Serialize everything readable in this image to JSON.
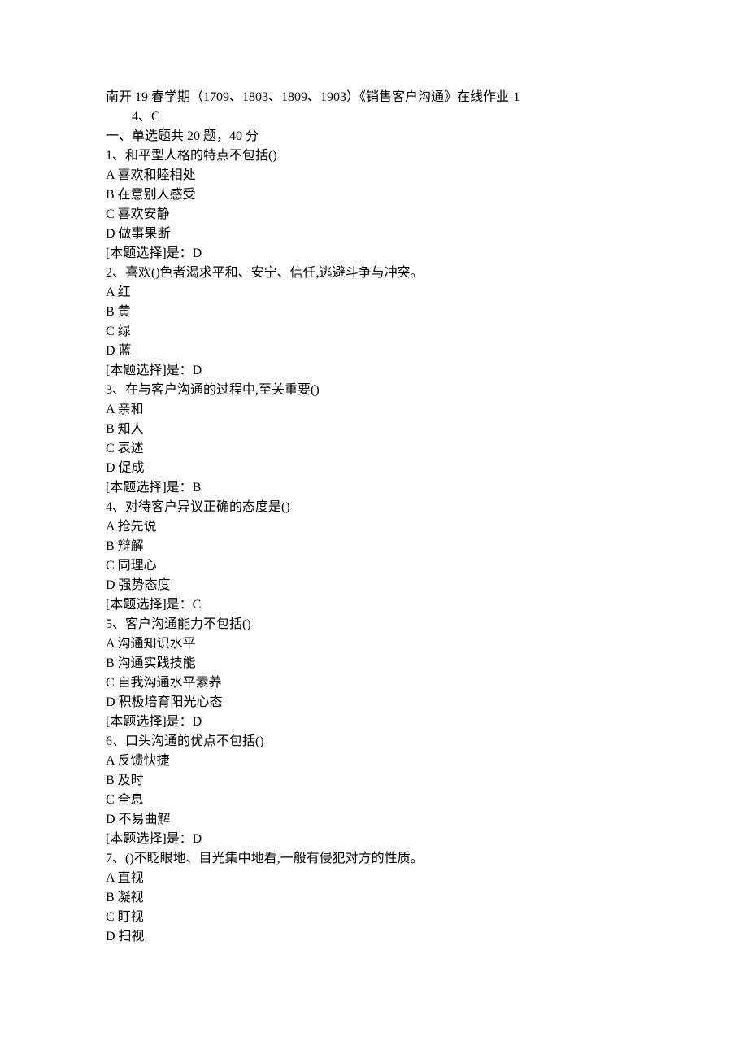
{
  "header": {
    "title_line": "南开 19 春学期（1709、1803、1809、1903）《销售客户沟通》在线作业-1",
    "sub_line": "4、C",
    "section_header": "一、单选题共 20 题，40 分"
  },
  "questions": [
    {
      "q": "1、和平型人格的特点不包括()",
      "opts": [
        "A 喜欢和睦相处",
        "B 在意别人感受",
        "C 喜欢安静",
        "D 做事果断"
      ],
      "ans": "[本题选择]是：D"
    },
    {
      "q": "2、喜欢()色者渴求平和、安宁、信任,逃避斗争与冲突。",
      "opts": [
        "A 红",
        "B 黄",
        "C 绿",
        "D 蓝"
      ],
      "ans": "[本题选择]是：D"
    },
    {
      "q": "3、在与客户沟通的过程中,至关重要()",
      "opts": [
        "A 亲和",
        "B 知人",
        "C 表述",
        "D 促成"
      ],
      "ans": "[本题选择]是：B"
    },
    {
      "q": "4、对待客户异议正确的态度是()",
      "opts": [
        "A 抢先说",
        "B 辩解",
        "C 同理心",
        "D 强势态度"
      ],
      "ans": "[本题选择]是：C"
    },
    {
      "q": "5、客户沟通能力不包括()",
      "opts": [
        "A 沟通知识水平",
        "B 沟通实践技能",
        "C 自我沟通水平素养",
        "D 积极培育阳光心态"
      ],
      "ans": "[本题选择]是：D"
    },
    {
      "q": "6、口头沟通的优点不包括()",
      "opts": [
        "A 反馈快捷",
        "B 及时",
        "C 全息",
        "D 不易曲解"
      ],
      "ans": "[本题选择]是：D"
    },
    {
      "q": "7、()不眨眼地、目光集中地看,一般有侵犯对方的性质。",
      "opts": [
        "A 直视",
        "B 凝视",
        "C 盯视",
        "D 扫视"
      ],
      "ans": ""
    }
  ]
}
